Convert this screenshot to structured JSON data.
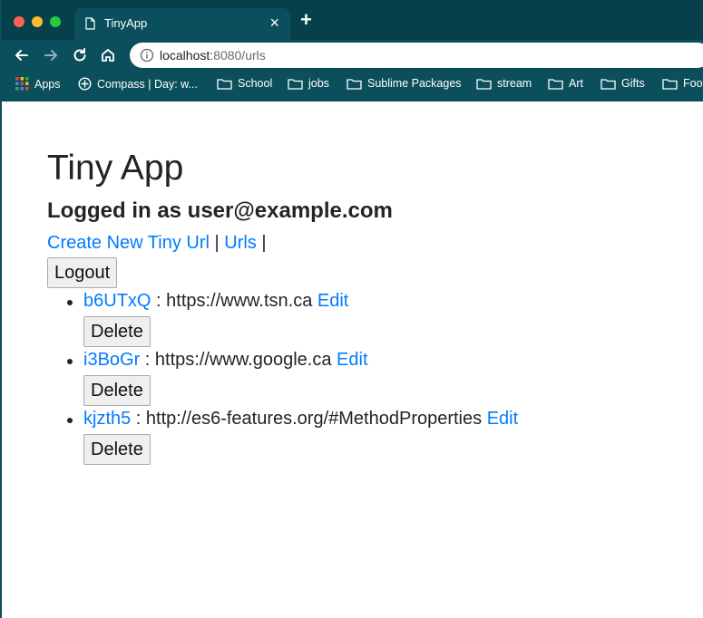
{
  "browser": {
    "tab_title": "TinyApp",
    "url_host": "localhost",
    "url_rest": ":8080/urls",
    "bookmarks": [
      {
        "label": "Apps",
        "icon": "apps-grid-icon"
      },
      {
        "label": "Compass | Day: w...",
        "icon": "compass-icon"
      },
      {
        "label": "School",
        "icon": "folder-icon"
      },
      {
        "label": "jobs",
        "icon": "folder-icon"
      },
      {
        "label": "Sublime Packages",
        "icon": "folder-icon"
      },
      {
        "label": "stream",
        "icon": "folder-icon"
      },
      {
        "label": "Art",
        "icon": "folder-icon"
      },
      {
        "label": "Gifts",
        "icon": "folder-icon"
      },
      {
        "label": "Foo",
        "icon": "folder-icon"
      }
    ]
  },
  "page": {
    "title": "Tiny App",
    "logged_in": "Logged in as user@example.com",
    "nav": {
      "create_label": "Create New Tiny Url",
      "sep1": " | ",
      "urls_label": "Urls",
      "sep2": " |"
    },
    "logout_label": "Logout",
    "urls": [
      {
        "short": "b6UTxQ",
        "long": " : https://www.tsn.ca ",
        "edit_label": "Edit",
        "delete_label": "Delete"
      },
      {
        "short": "i3BoGr",
        "long": " : https://www.google.ca ",
        "edit_label": "Edit",
        "delete_label": "Delete"
      },
      {
        "short": "kjzth5",
        "long": " : http://es6-features.org/#MethodProperties ",
        "edit_label": "Edit",
        "delete_label": "Delete"
      }
    ]
  },
  "colors": {
    "chrome_bg": "#0b4f5c",
    "tabbar_bg": "#06404b",
    "link": "#007bff",
    "text": "#212529"
  }
}
